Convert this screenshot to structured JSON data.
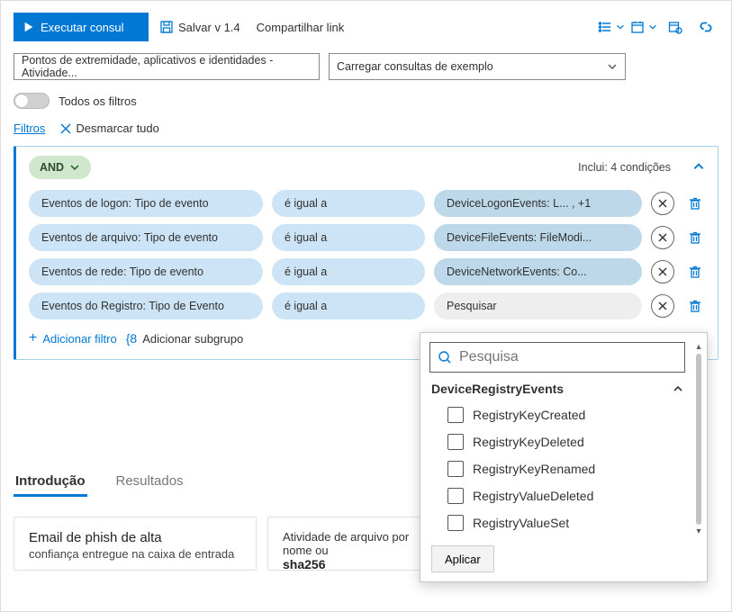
{
  "toolbar": {
    "run_label": "Executar consul",
    "save_label": "Salvar v 1.4",
    "share_label": "Compartilhar link"
  },
  "selectors": {
    "scope_label": "Pontos de extremidade, aplicativos e identidades - Atividade...",
    "samples_label": "Carregar consultas de exemplo"
  },
  "toggle_label": "Todos os filtros",
  "filters_label": "Filtros",
  "clear_all_label": "Desmarcar tudo",
  "builder": {
    "and_label": "AND",
    "includes_label": "Inclui: 4 condições",
    "conditions": [
      {
        "field": "Eventos de logon: Tipo de evento",
        "op": "é igual a",
        "value": "DeviceLogonEvents: L... , +1"
      },
      {
        "field": "Eventos de arquivo: Tipo de evento",
        "op": "é igual a",
        "value": "DeviceFileEvents: FileModi..."
      },
      {
        "field": "Eventos de rede: Tipo de evento",
        "op": "é igual a",
        "value": "DeviceNetworkEvents: Co..."
      },
      {
        "field": "Eventos do Registro: Tipo de Evento",
        "op": "é igual a",
        "value": "Pesquisar",
        "search": true
      }
    ],
    "add_filter_label": "Adicionar filtro",
    "add_subgroup_label": "Adicionar subgrupo"
  },
  "popover": {
    "search_placeholder": "Pesquisa",
    "group": "DeviceRegistryEvents",
    "options": [
      "RegistryKeyCreated",
      "RegistryKeyDeleted",
      "RegistryKeyRenamed",
      "RegistryValueDeleted",
      "RegistryValueSet"
    ],
    "apply_label": "Aplicar"
  },
  "tabs": {
    "intro": "Introdução",
    "results": "Resultados"
  },
  "cards": {
    "c1_title": "Email de phish de alta",
    "c1_sub": "confiança entregue na caixa de entrada",
    "c2_title": "Atividade de arquivo por nome ou",
    "c2_sub": "sha256"
  }
}
